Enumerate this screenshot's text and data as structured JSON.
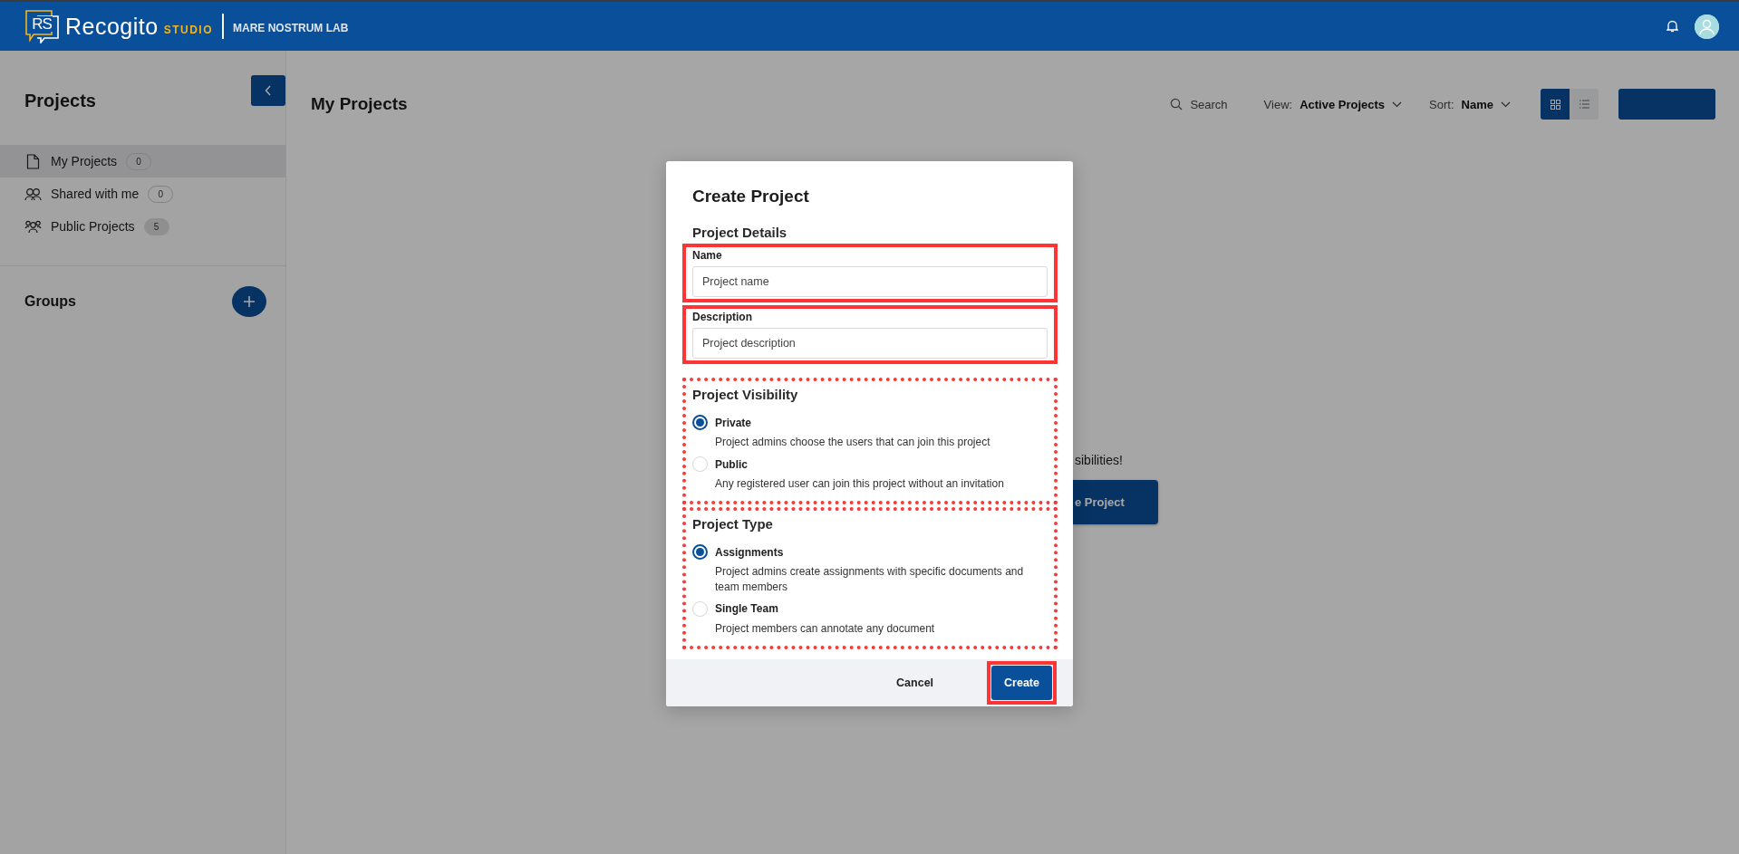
{
  "header": {
    "logo_mark": "RS",
    "brand": "Recogito",
    "edition": "STUDIO",
    "org": "MARE NOSTRUM LAB"
  },
  "sidebar": {
    "title": "Projects",
    "items": [
      {
        "label": "My Projects",
        "count": "0",
        "kind": "outline",
        "selected": true
      },
      {
        "label": "Shared with me",
        "count": "0",
        "kind": "outline",
        "selected": false
      },
      {
        "label": "Public Projects",
        "count": "5",
        "kind": "filled",
        "selected": false
      }
    ],
    "groups_title": "Groups"
  },
  "main": {
    "title": "My Projects",
    "search": "Search",
    "view": {
      "label": "View:",
      "value": "Active Projects"
    },
    "sort": {
      "label": "Sort:",
      "value": "Name"
    },
    "layout_toggle": [
      {
        "kind": "grid",
        "selected": true
      },
      {
        "kind": "list",
        "selected": false
      }
    ],
    "empty_state": {
      "message": "sibilities!",
      "button": "e Project"
    }
  },
  "dialog": {
    "title": "Create Project",
    "sections": [
      {
        "kind": "fields",
        "title": "Project Details",
        "fields": [
          {
            "label": "Name",
            "placeholder": "Project name",
            "highlighted": true
          },
          {
            "label": "Description",
            "placeholder": "Project description",
            "highlighted": true
          }
        ]
      },
      {
        "kind": "radio",
        "title": "Project Visibility",
        "highlighted": true,
        "options": [
          {
            "label": "Private",
            "description": "Project admins choose the users that can join this project",
            "selected": true
          },
          {
            "label": "Public",
            "description": "Any registered user can join this project without an invitation",
            "selected": false
          }
        ]
      },
      {
        "kind": "radio",
        "title": "Project Type",
        "highlighted": true,
        "options": [
          {
            "label": "Assignments",
            "description": "Project admins create assignments with specific documents and team members",
            "selected": true
          },
          {
            "label": "Single Team",
            "description": "Project members can annotate any document",
            "selected": false
          }
        ]
      }
    ],
    "buttons": [
      {
        "label": "Cancel",
        "kind": "secondary",
        "highlighted": false
      },
      {
        "label": "Create",
        "kind": "primary",
        "highlighted": true
      }
    ]
  }
}
